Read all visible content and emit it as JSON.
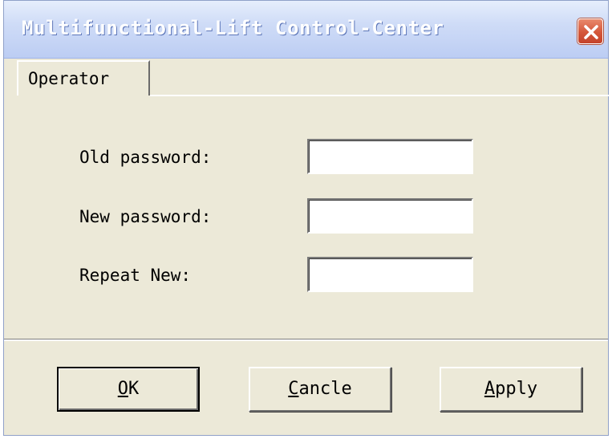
{
  "window": {
    "title": "Multifunctional-Lift Control-Center",
    "close_icon": "close-icon"
  },
  "tabs": [
    {
      "label": "Operator",
      "selected": true
    }
  ],
  "form": {
    "old_password": {
      "label": "Old password:",
      "value": ""
    },
    "new_password": {
      "label": "New password:",
      "value": ""
    },
    "repeat_new": {
      "label": "Repeat New:",
      "value": ""
    }
  },
  "buttons": {
    "ok": {
      "accel": "O",
      "rest": "K"
    },
    "cancel": {
      "accel": "C",
      "rest": "ancle"
    },
    "apply": {
      "accel": "A",
      "rest": "pply"
    }
  },
  "colors": {
    "window_bg": "#ece9d8",
    "close_red": "#d4573a",
    "titlebar_blue": "#bccdf3"
  }
}
